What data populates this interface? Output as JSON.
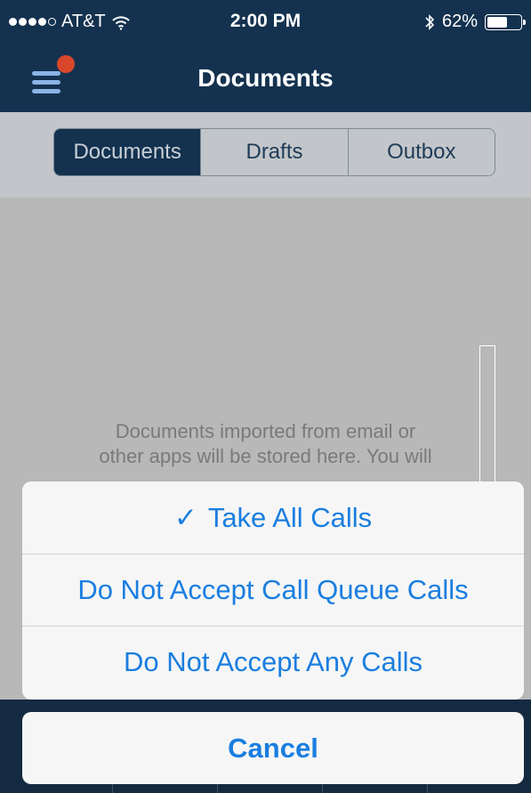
{
  "status_bar": {
    "carrier": "AT&T",
    "time": "2:00 PM",
    "battery_percent": "62%",
    "battery_level": 0.62,
    "icons": [
      "signal-dots-icon",
      "wifi-icon",
      "bluetooth-icon",
      "battery-icon"
    ]
  },
  "nav": {
    "title": "Documents",
    "menu_icon": "hamburger-menu-icon",
    "notification_badge_color": "#d9472b"
  },
  "segments": {
    "items": [
      {
        "label": "Documents",
        "active": true
      },
      {
        "label": "Drafts",
        "active": false
      },
      {
        "label": "Outbox",
        "active": false
      }
    ]
  },
  "content": {
    "message_line1": "Documents imported from email or",
    "message_line2": "other apps will be stored here. You will"
  },
  "action_sheet": {
    "options": [
      {
        "label": "Take All Calls",
        "checked": true,
        "check_glyph": "✓"
      },
      {
        "label": "Do Not Accept Call Queue Calls",
        "checked": false
      },
      {
        "label": "Do Not Accept Any Calls",
        "checked": false
      }
    ],
    "cancel_label": "Cancel"
  },
  "colors": {
    "nav_background": "#14324f",
    "action_text": "#1a7ee0",
    "dim_overlay": "#b8b8b8"
  }
}
